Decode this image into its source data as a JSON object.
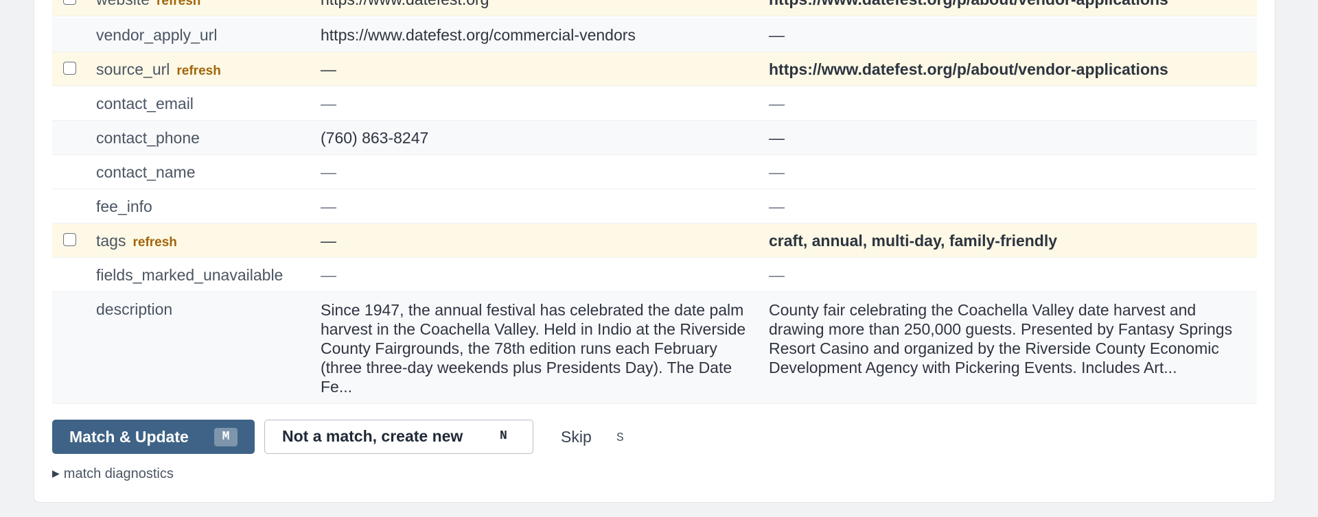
{
  "rows": [
    {
      "field": "website",
      "refresh": "refresh",
      "current": "https://www.datefest.org",
      "proposed": "https://www.datefest.org/p/about/vendor-applications"
    },
    {
      "field": "vendor_apply_url",
      "current": "https://www.datefest.org/commercial-vendors",
      "proposed": "—"
    },
    {
      "field": "source_url",
      "refresh": "refresh",
      "current": "—",
      "proposed": "https://www.datefest.org/p/about/vendor-applications"
    },
    {
      "field": "contact_email",
      "current": "—",
      "proposed": "—"
    },
    {
      "field": "contact_phone",
      "current": "(760) 863-8247",
      "proposed": "—"
    },
    {
      "field": "contact_name",
      "current": "—",
      "proposed": "—"
    },
    {
      "field": "fee_info",
      "current": "—",
      "proposed": "—"
    },
    {
      "field": "tags",
      "refresh": "refresh",
      "current": "—",
      "proposed": "craft, annual, multi-day, family-friendly"
    },
    {
      "field": "fields_marked_unavailable",
      "current": "—",
      "proposed": "—"
    },
    {
      "field": "description",
      "current": "Since 1947, the annual festival has celebrated the date palm harvest in the Coachella Valley. Held in Indio at the Riverside County Fairgrounds, the 78th edition runs each February (three three-day weekends plus Presidents Day). The Date Fe...",
      "proposed": "County fair celebrating the Coachella Valley date harvest and drawing more than 250,000 guests. Presented by Fantasy Springs Resort Casino and organized by the Riverside County Economic Development Agency with Pickering Events. Includes Art..."
    }
  ],
  "actions": {
    "match_label": "Match & Update",
    "match_key": "M",
    "new_label": "Not a match, create new",
    "new_key": "N",
    "skip_label": "Skip",
    "skip_key": "S"
  },
  "diagnostics": {
    "label": "match diagnostics",
    "toggle_icon": "▶"
  }
}
